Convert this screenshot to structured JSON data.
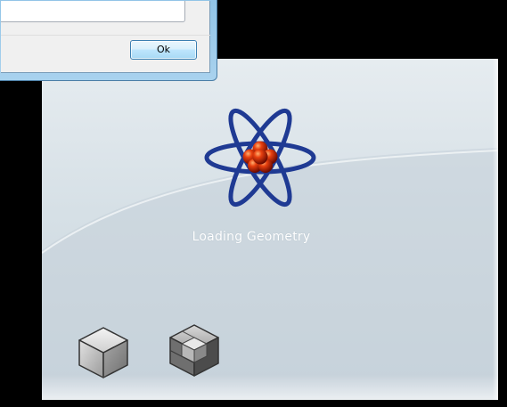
{
  "dialog": {
    "ok_label": "Ok",
    "textarea_value": ""
  },
  "splash": {
    "status_text": "Loading Geometry",
    "logo_icon": "atom-icon",
    "tool_icons": [
      "solid-cube-icon",
      "split-cube-icon"
    ]
  },
  "colors": {
    "background": "#000000",
    "splash_top": "#e6ecf0",
    "splash_bottom": "#c9d5dd",
    "atom_orbit": "#1f3a93",
    "nucleus": "#c0200a",
    "text": "#ffffff",
    "dialog_border": "#4b7ea6"
  }
}
